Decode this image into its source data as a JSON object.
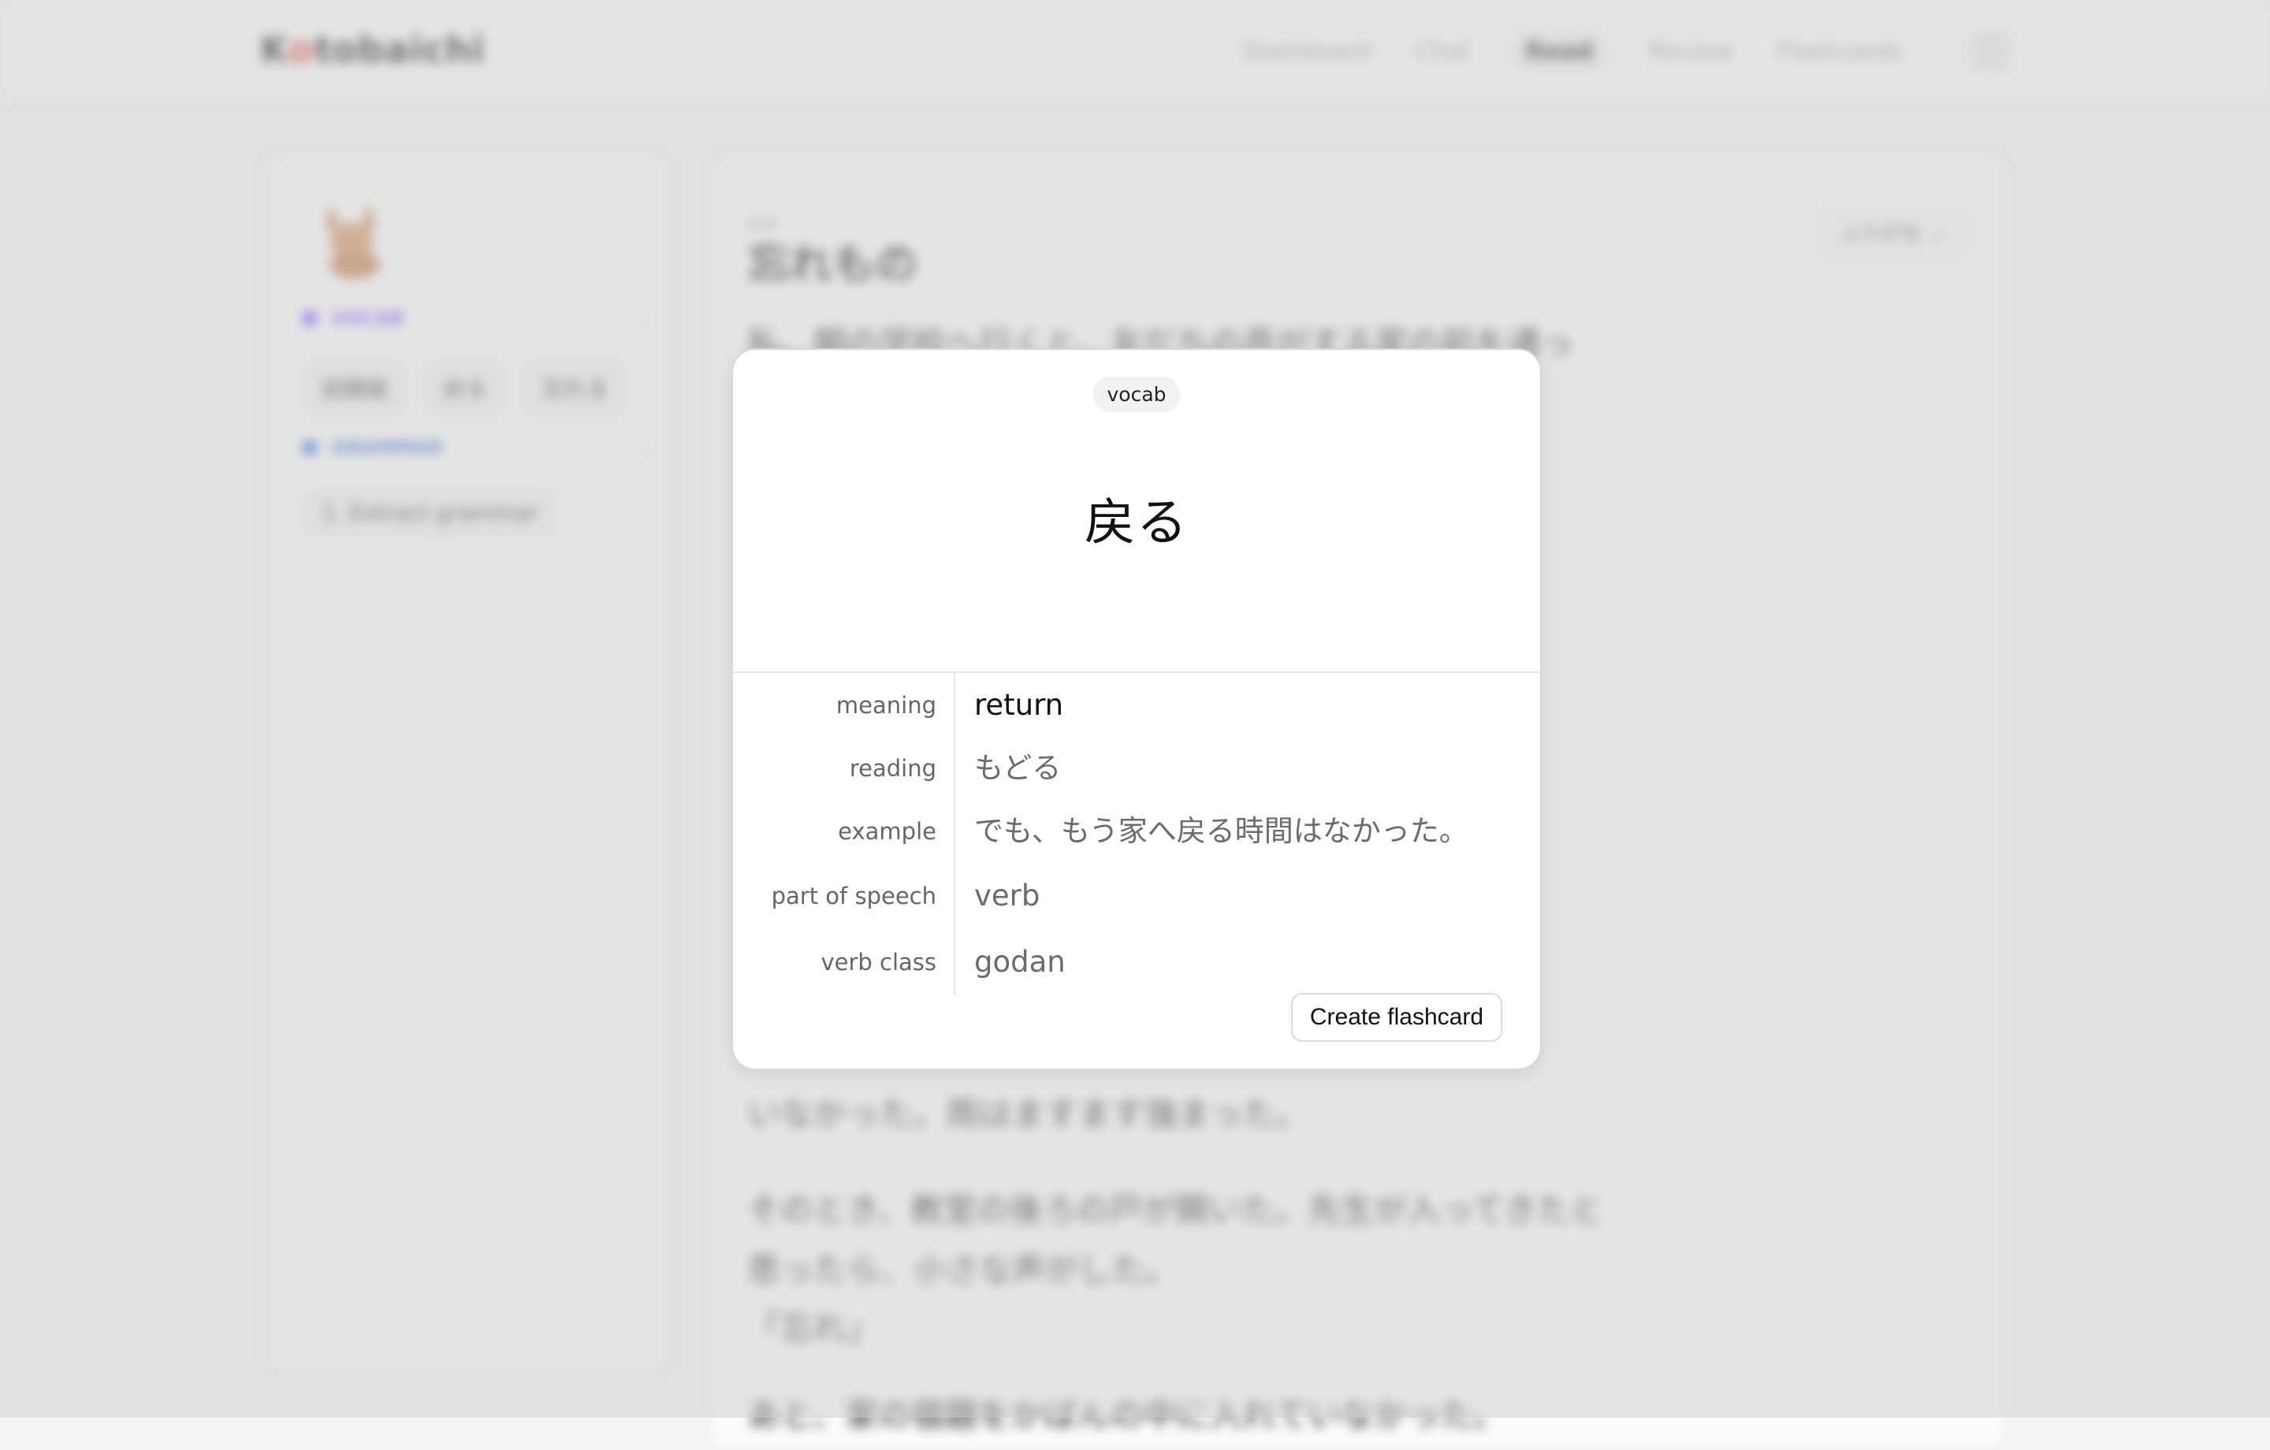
{
  "nav": {
    "logo_first": "K",
    "logo_mark": "o",
    "logo_rest": "tobaichi",
    "links": [
      "Dashboard",
      "Chat",
      "Read",
      "Review",
      "Flashcards"
    ],
    "active_link": "Read"
  },
  "sidebar": {
    "vocab_header": "VOCAB",
    "vocab_chips": [
      "話題曲",
      "戻る",
      "忘れる"
    ],
    "grammar_header": "GRAMMAR",
    "grammar_chip": "1. Extract grammar"
  },
  "document": {
    "title_furigana": "わす",
    "title": "忘れもの",
    "furigana_button": "ふりがな",
    "paragraphs": [
      "私、朝の学校へ行くと、友だちの声がする家の前を通った。",
      "いなかった。雨はますます強まった。",
      "そのとき、教室の後ろの戸が開いた。先生が入ってきたと思ったら、小さな声がした。",
      "「忘れ」",
      "あと、家の宿題をかばんの中に入れていなかった。"
    ]
  },
  "card": {
    "badge": "vocab",
    "word": "戻る",
    "fields": [
      {
        "label": "meaning",
        "value": "return"
      },
      {
        "label": "reading",
        "value": "もどる"
      },
      {
        "label": "example",
        "value": "でも、もう家へ戻る時間はなかった。"
      },
      {
        "label": "part of speech",
        "value": "verb"
      },
      {
        "label": "verb class",
        "value": "godan"
      }
    ],
    "button": "Create flashcard"
  },
  "colors": {
    "vocab_accent": "#7c4dff",
    "grammar_accent": "#3b6fd8",
    "logo_accent": "#e53935"
  }
}
